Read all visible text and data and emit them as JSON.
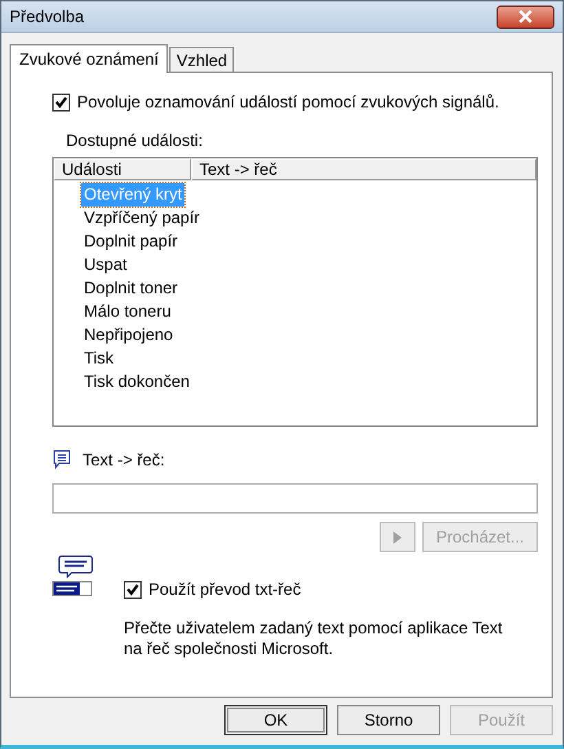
{
  "window": {
    "title": "Předvolba"
  },
  "tabs": [
    {
      "label": "Zvukové oznámení",
      "selected": true
    },
    {
      "label": "Vzhled",
      "selected": false
    }
  ],
  "enable_option": {
    "label": "Povoluje oznamování událostí pomocí zvukových signálů.",
    "checked": true
  },
  "events_label": "Dostupné události:",
  "events_table": {
    "columns": [
      "Události",
      "Text  -> řeč"
    ],
    "rows": [
      {
        "label": "Otevřený kryt",
        "selected": true
      },
      {
        "label": "Vzpříčený papír",
        "selected": false
      },
      {
        "label": "Doplnit papír",
        "selected": false
      },
      {
        "label": "Uspat",
        "selected": false
      },
      {
        "label": "Doplnit toner",
        "selected": false
      },
      {
        "label": "Málo toneru",
        "selected": false
      },
      {
        "label": "Nepřipojeno",
        "selected": false
      },
      {
        "label": "Tisk",
        "selected": false
      },
      {
        "label": "Tisk dokončen",
        "selected": false
      }
    ]
  },
  "tts_label": "Text  -> řeč:",
  "play_button": {
    "disabled": true
  },
  "browse_button": {
    "label": "Procházet...",
    "disabled": true
  },
  "use_tts_option": {
    "label": "Použít převod txt-řeč",
    "checked": true
  },
  "description": "Přečte uživatelem zadaný text pomocí aplikace Text na řeč společnosti Microsoft.",
  "buttons": [
    {
      "label": "OK",
      "disabled": false,
      "default": true
    },
    {
      "label": "Storno",
      "disabled": false,
      "default": false
    },
    {
      "label": "Použít",
      "disabled": true,
      "default": false
    }
  ]
}
